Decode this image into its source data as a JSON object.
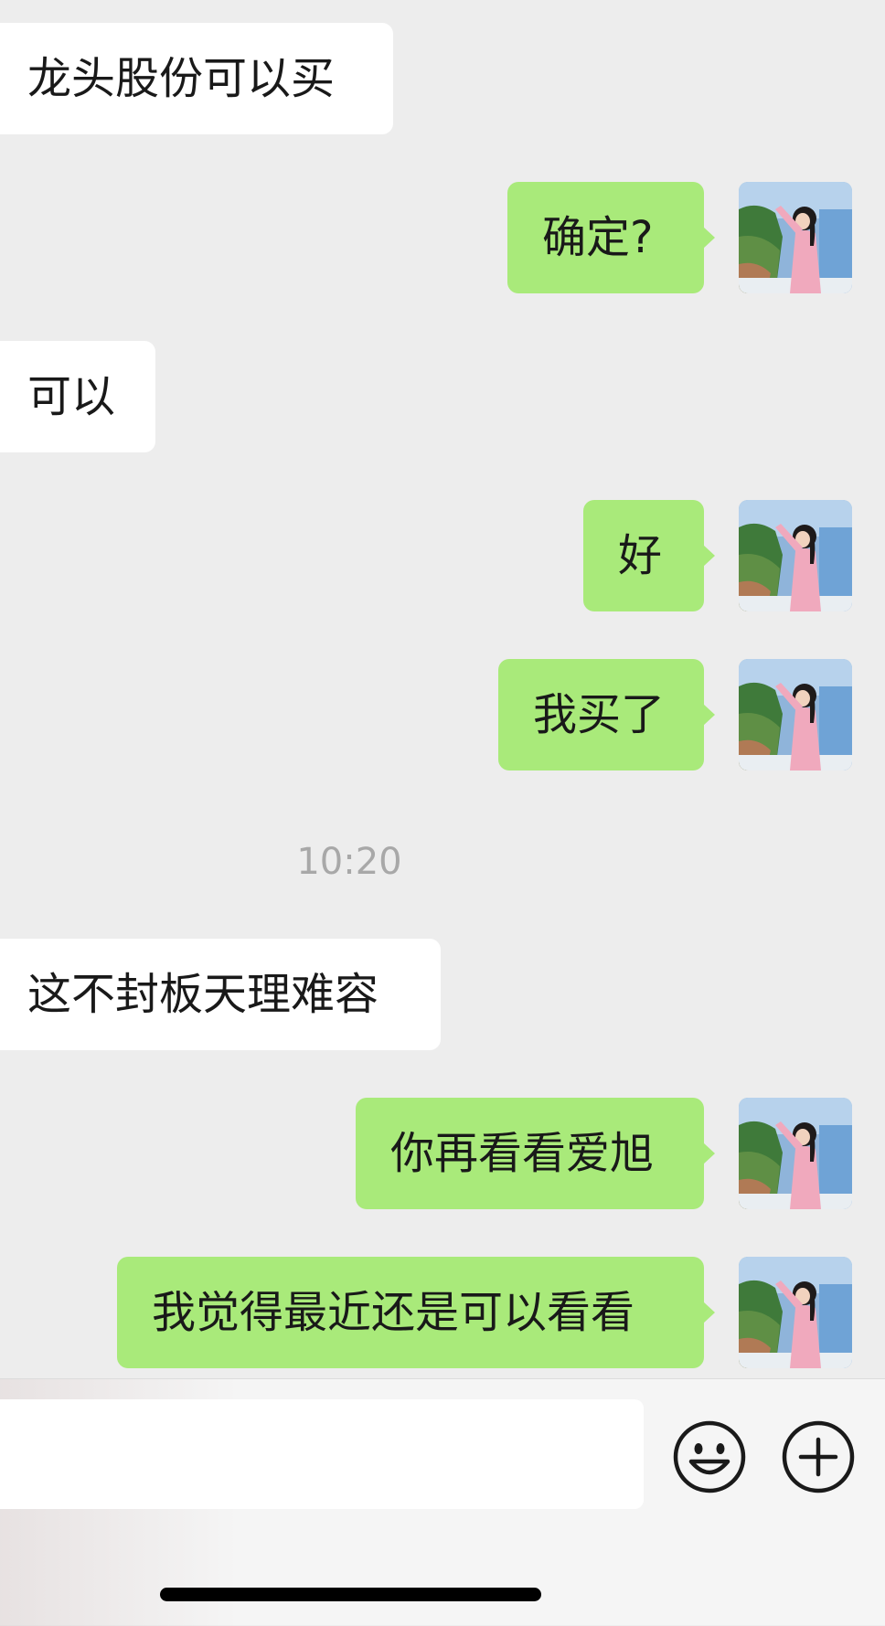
{
  "messages": [
    {
      "side": "in",
      "text": "龙头股份可以买"
    },
    {
      "side": "out",
      "text": "确定?"
    },
    {
      "side": "in",
      "text": "可以"
    },
    {
      "side": "out",
      "text": "好"
    },
    {
      "side": "out",
      "text": "我买了"
    },
    {
      "side": "in",
      "text": "这不封板天理难容"
    },
    {
      "side": "out",
      "text": "你再看看爱旭"
    },
    {
      "side": "out",
      "text": "我觉得最近还是可以看看"
    }
  ],
  "timestamp": "10:20",
  "input": {
    "placeholder": ""
  },
  "colors": {
    "background": "#ededed",
    "incoming_bubble": "#ffffff",
    "outgoing_bubble": "#a9ea7a",
    "timestamp": "#a8a8a8"
  },
  "icons": {
    "emoji": "emoji-smiley-icon",
    "more": "plus-circle-icon",
    "avatar": "user-avatar-photo"
  }
}
